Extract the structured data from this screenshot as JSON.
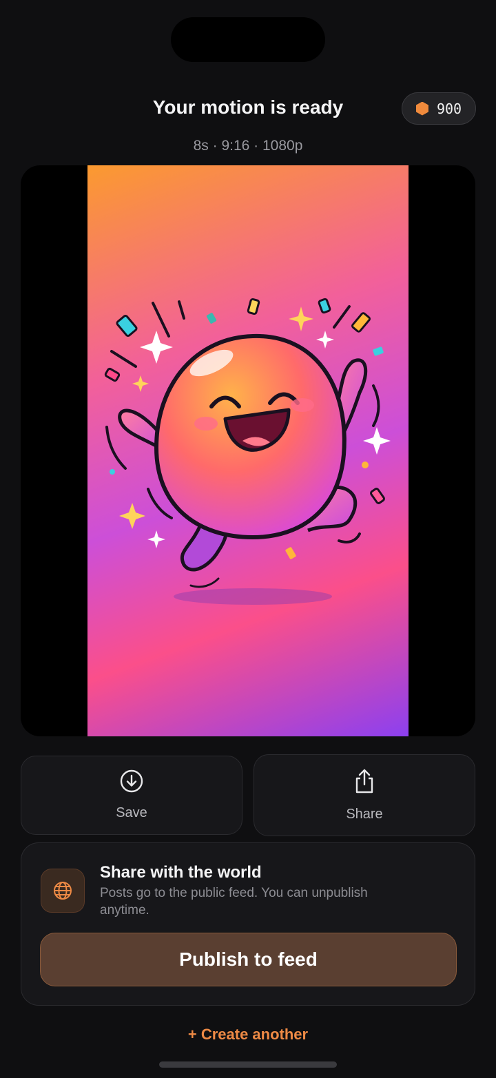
{
  "header": {
    "title": "Your motion is ready",
    "credits": "900",
    "credits_icon": "hexagon-coin-icon",
    "meta": "8s · 9:16 · 1080p"
  },
  "actions": {
    "save_label": "Save",
    "save_icon": "download-circle-icon",
    "share_label": "Share",
    "share_icon": "share-upload-icon"
  },
  "world": {
    "icon": "globe-icon",
    "title": "Share with the world",
    "description": "Posts go to the public feed. You can unpublish anytime.",
    "publish_label": "Publish to feed"
  },
  "create_another": "+ Create another",
  "colors": {
    "accent": "#ee8a45",
    "background": "#0f0f11",
    "card": "#17171a",
    "publish_button": "#5a3f31"
  }
}
